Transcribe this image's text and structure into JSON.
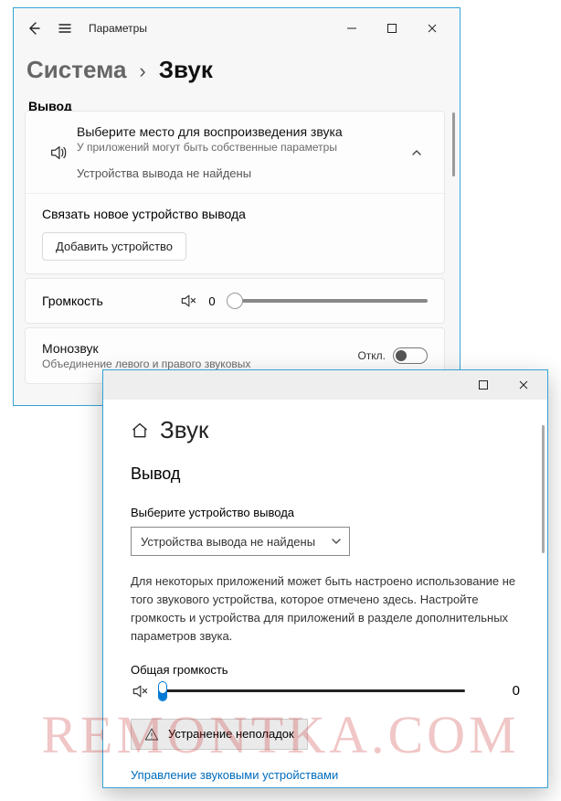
{
  "win1": {
    "title": "Параметры",
    "breadcrumb": {
      "parent": "Система",
      "current": "Звук"
    },
    "section": "Вывод",
    "output": {
      "heading": "Выберите место для воспроизведения звука",
      "sub": "У приложений могут быть собственные параметры",
      "notfound": "Устройства вывода не найдены",
      "linknew": "Связать новое устройство вывода",
      "addbtn": "Добавить устройство"
    },
    "volume": {
      "label": "Громкость",
      "value": "0"
    },
    "mono": {
      "label": "Монозвук",
      "sub": "Объединение левого и правого звуковых",
      "state": "Откл."
    }
  },
  "win2": {
    "page": "Звук",
    "section": "Вывод",
    "select_label": "Выберите устройство вывода",
    "select_value": "Устройства вывода не найдены",
    "paragraph": "Для некоторых приложений может быть настроено использование не того звукового устройства, которое отмечено здесь. Настройте громкость и устройства для приложений в разделе дополнительных параметров звука.",
    "master_label": "Общая громкость",
    "master_value": "0",
    "troubleshoot": "Устранение неполадок",
    "manage_link": "Управление звуковыми устройствами"
  },
  "watermark": "REMONTKA.COM"
}
